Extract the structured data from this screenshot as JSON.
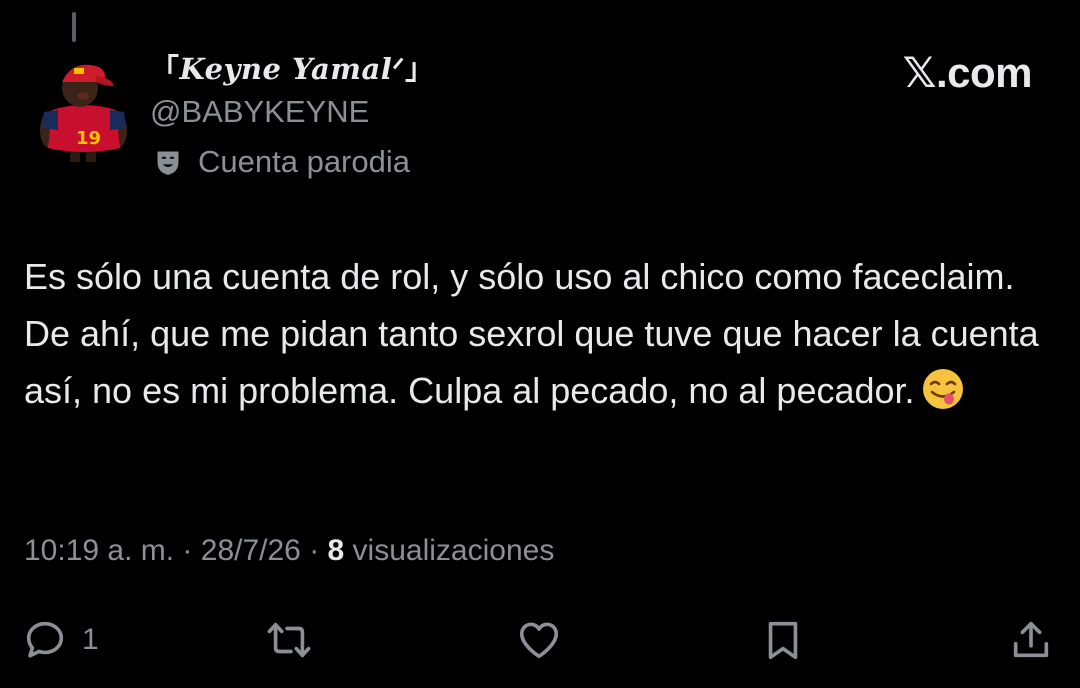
{
  "author": {
    "display_name_open": "「",
    "display_name": "Keyne Yamal",
    "display_name_mark": "ᐟ",
    "display_name_close": "」",
    "handle": "@BABYKEYNE",
    "label": "Cuenta parodia",
    "label_icon": "theater-masks-icon",
    "avatar_jersey_number": "19"
  },
  "brand": "𝕏.com",
  "tweet": {
    "text": "Es sólo una cuenta de rol, y sólo uso al chico como faceclaim. De ahí, que me pidan tanto sexrol que tuve que hacer la cuenta así, no es mi problema. Culpa al pecado, no al pecador.",
    "emoji": "face-savoring-food-emoji"
  },
  "meta": {
    "time": "10:19 a. m.",
    "sep1": " · ",
    "date": "28/7/26",
    "sep2": " · ",
    "views_count": "8",
    "views_label": " visualizaciones"
  },
  "actions": {
    "reply_count": "1",
    "icons": [
      "reply-icon",
      "retweet-icon",
      "like-icon",
      "bookmark-icon",
      "share-icon"
    ]
  },
  "colors": {
    "background": "#000000",
    "text_primary": "#e7e9ea",
    "text_secondary": "#8b9096"
  }
}
